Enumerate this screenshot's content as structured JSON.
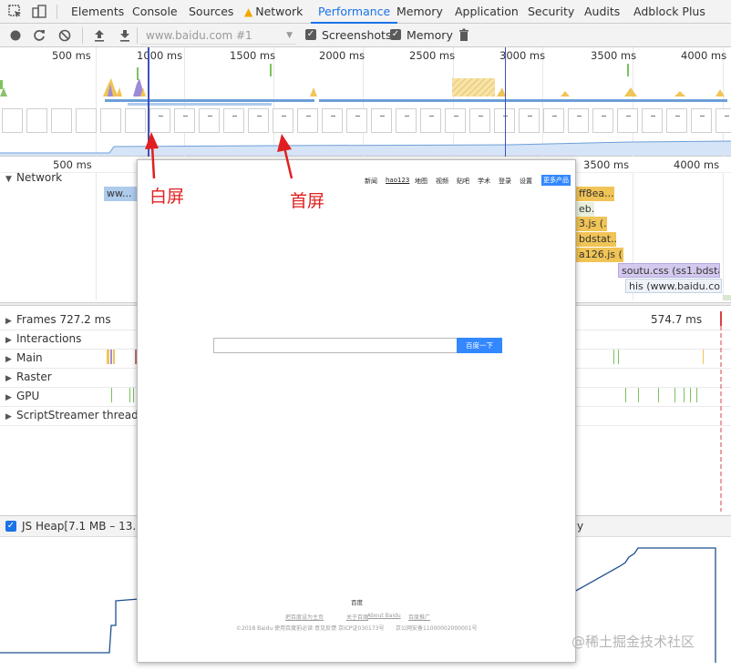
{
  "tabs": [
    {
      "label": "Elements",
      "active": false
    },
    {
      "label": "Console",
      "active": false
    },
    {
      "label": "Sources",
      "active": false
    },
    {
      "label": "Network",
      "active": false,
      "warning": true
    },
    {
      "label": "Performance",
      "active": true
    },
    {
      "label": "Memory",
      "active": false
    },
    {
      "label": "Application",
      "active": false
    },
    {
      "label": "Security",
      "active": false
    },
    {
      "label": "Audits",
      "active": false
    },
    {
      "label": "Adblock Plus",
      "active": false
    }
  ],
  "toolbar": {
    "url_value": "www.baidu.com #1",
    "screenshots_label": "Screenshots",
    "screenshots_checked": true,
    "memory_label": "Memory",
    "memory_checked": true
  },
  "overview_ticks": [
    "500 ms",
    "1000 ms",
    "1500 ms",
    "2000 ms",
    "2500 ms",
    "3000 ms",
    "3500 ms",
    "4000 ms"
  ],
  "details_ticks": [
    "500 ms",
    "1000 ms",
    "1500 ms",
    "2000 ms",
    "2500 ms",
    "3000 ms",
    "3500 ms",
    "4000 ms"
  ],
  "network": {
    "label": "Network",
    "requests": [
      "ww...",
      "ff8ea...",
      "eb...",
      "3.js (...",
      "bdstat...",
      "a126.js (...",
      "soutu.css (ss1.bdsta...",
      "his (www.baidu.com)"
    ]
  },
  "tracks": [
    {
      "label": "Frames 727.2 ms",
      "extra": "574.7 ms"
    },
    {
      "label": "Interactions"
    },
    {
      "label": "Main"
    },
    {
      "label": "Raster"
    },
    {
      "label": "GPU"
    },
    {
      "label": "ScriptStreamer thread"
    }
  ],
  "heap": {
    "label": "JS Heap[7.1 MB – 13.2 M",
    "suffix": "y",
    "checked": true
  },
  "screenshot": {
    "nav_links": [
      "新闻",
      "hao123",
      "地图",
      "视频",
      "贴吧",
      "学术",
      "登录",
      "设置"
    ],
    "more_button": "更多产品",
    "search_button": "百度一下",
    "footer_brand": "百度",
    "footer_links": [
      "把百度设为主页",
      "关于百度",
      "About  Baidu",
      "百度推广"
    ],
    "footer_legal": "©2018 Baidu 使用百度前必读 意见反馈 京ICP证030173号",
    "footer_police": "京公网安备11000002000001号"
  },
  "annotations": {
    "white_screen": "白屏",
    "first_screen": "首屏"
  },
  "watermark": "@稀土掘金技术社区",
  "colors": {
    "accent": "#1a73e8",
    "annotation": "#e02020",
    "heap_line": "#1f4f8f",
    "network_js": "#f0c456",
    "network_doc": "#aecbec",
    "network_css": "#d3c9ee"
  }
}
